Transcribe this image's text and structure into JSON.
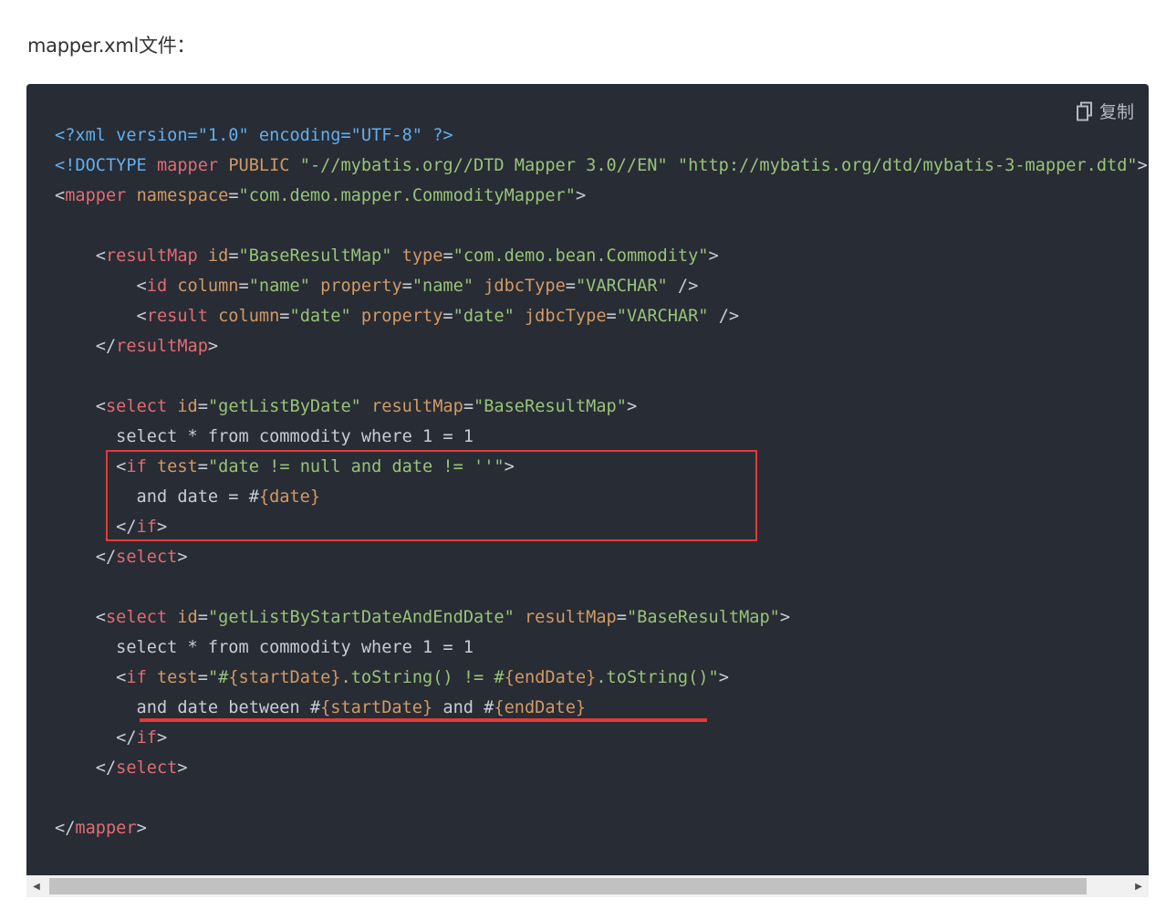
{
  "intro_text": "mapper.xml文件：",
  "copy_button": {
    "label": "复制",
    "icon": "copy-icon"
  },
  "colors": {
    "code_background": "#282c34",
    "tag": "#e06c75",
    "attribute": "#d19a66",
    "string": "#98c379",
    "declaration": "#61afef",
    "text": "#c8ccd4",
    "highlight": "#e53935"
  },
  "code_lines": [
    [
      [
        "decl",
        "<?xml version=\"1.0\" encoding=\"UTF-8\" ?>"
      ]
    ],
    [
      [
        "decl",
        "<!DOCTYPE "
      ],
      [
        "tag",
        "mapper"
      ],
      [
        "attr",
        " PUBLIC "
      ],
      [
        "str",
        "\"-//mybatis.org//DTD Mapper 3.0//EN\" \"http://mybatis.org/dtd/mybatis-3-mapper.dtd\""
      ],
      [
        "punct",
        ">"
      ]
    ],
    [
      [
        "punct",
        "<"
      ],
      [
        "tag",
        "mapper"
      ],
      [
        "attr",
        " namespace"
      ],
      [
        "punct",
        "="
      ],
      [
        "str",
        "\"com.demo.mapper.CommodityMapper\""
      ],
      [
        "punct",
        ">"
      ]
    ],
    [
      [
        "text",
        ""
      ]
    ],
    [
      [
        "punct",
        "    <"
      ],
      [
        "tag",
        "resultMap"
      ],
      [
        "attr",
        " id"
      ],
      [
        "punct",
        "="
      ],
      [
        "str",
        "\"BaseResultMap\""
      ],
      [
        "attr",
        " type"
      ],
      [
        "punct",
        "="
      ],
      [
        "str",
        "\"com.demo.bean.Commodity\""
      ],
      [
        "punct",
        ">"
      ]
    ],
    [
      [
        "punct",
        "        <"
      ],
      [
        "tag",
        "id"
      ],
      [
        "attr",
        " column"
      ],
      [
        "punct",
        "="
      ],
      [
        "str",
        "\"name\""
      ],
      [
        "attr",
        " property"
      ],
      [
        "punct",
        "="
      ],
      [
        "str",
        "\"name\""
      ],
      [
        "attr",
        " jdbcType"
      ],
      [
        "punct",
        "="
      ],
      [
        "str",
        "\"VARCHAR\""
      ],
      [
        "punct",
        " />"
      ]
    ],
    [
      [
        "punct",
        "        <"
      ],
      [
        "tag",
        "result"
      ],
      [
        "attr",
        " column"
      ],
      [
        "punct",
        "="
      ],
      [
        "str",
        "\"date\""
      ],
      [
        "attr",
        " property"
      ],
      [
        "punct",
        "="
      ],
      [
        "str",
        "\"date\""
      ],
      [
        "attr",
        " jdbcType"
      ],
      [
        "punct",
        "="
      ],
      [
        "str",
        "\"VARCHAR\""
      ],
      [
        "punct",
        " />"
      ]
    ],
    [
      [
        "punct",
        "    </"
      ],
      [
        "tag",
        "resultMap"
      ],
      [
        "punct",
        ">"
      ]
    ],
    [
      [
        "text",
        ""
      ]
    ],
    [
      [
        "punct",
        "    <"
      ],
      [
        "tag",
        "select"
      ],
      [
        "attr",
        " id"
      ],
      [
        "punct",
        "="
      ],
      [
        "str",
        "\"getListByDate\""
      ],
      [
        "attr",
        " resultMap"
      ],
      [
        "punct",
        "="
      ],
      [
        "str",
        "\"BaseResultMap\""
      ],
      [
        "punct",
        ">"
      ]
    ],
    [
      [
        "text",
        "      select * from commodity where 1 = 1"
      ]
    ],
    [
      [
        "punct",
        "      <"
      ],
      [
        "tag",
        "if"
      ],
      [
        "attr",
        " test"
      ],
      [
        "punct",
        "="
      ],
      [
        "str",
        "\"date != null and date != ''\""
      ],
      [
        "punct",
        ">"
      ]
    ],
    [
      [
        "text",
        "        and date = #"
      ],
      [
        "expr",
        "{date}"
      ]
    ],
    [
      [
        "punct",
        "      </"
      ],
      [
        "tag",
        "if"
      ],
      [
        "punct",
        ">"
      ]
    ],
    [
      [
        "punct",
        "    </"
      ],
      [
        "tag",
        "select"
      ],
      [
        "punct",
        ">"
      ]
    ],
    [
      [
        "text",
        ""
      ]
    ],
    [
      [
        "punct",
        "    <"
      ],
      [
        "tag",
        "select"
      ],
      [
        "attr",
        " id"
      ],
      [
        "punct",
        "="
      ],
      [
        "str",
        "\"getListByStartDateAndEndDate\""
      ],
      [
        "attr",
        " resultMap"
      ],
      [
        "punct",
        "="
      ],
      [
        "str",
        "\"BaseResultMap\""
      ],
      [
        "punct",
        ">"
      ]
    ],
    [
      [
        "text",
        "      select * from commodity where 1 = 1"
      ]
    ],
    [
      [
        "punct",
        "      <"
      ],
      [
        "tag",
        "if"
      ],
      [
        "attr",
        " test"
      ],
      [
        "punct",
        "="
      ],
      [
        "str",
        "\"#"
      ],
      [
        "expr",
        "{startDate}"
      ],
      [
        "str",
        ".toString() != #"
      ],
      [
        "expr",
        "{endDate}"
      ],
      [
        "str",
        ".toString()\""
      ],
      [
        "punct",
        ">"
      ]
    ],
    [
      [
        "text",
        "        and date between #"
      ],
      [
        "expr",
        "{startDate}"
      ],
      [
        "text",
        " and #"
      ],
      [
        "expr",
        "{endDate}"
      ]
    ],
    [
      [
        "punct",
        "      </"
      ],
      [
        "tag",
        "if"
      ],
      [
        "punct",
        ">"
      ]
    ],
    [
      [
        "punct",
        "    </"
      ],
      [
        "tag",
        "select"
      ],
      [
        "punct",
        ">"
      ]
    ],
    [
      [
        "text",
        ""
      ]
    ],
    [
      [
        "punct",
        "</"
      ],
      [
        "tag",
        "mapper"
      ],
      [
        "punct",
        ">"
      ]
    ]
  ]
}
